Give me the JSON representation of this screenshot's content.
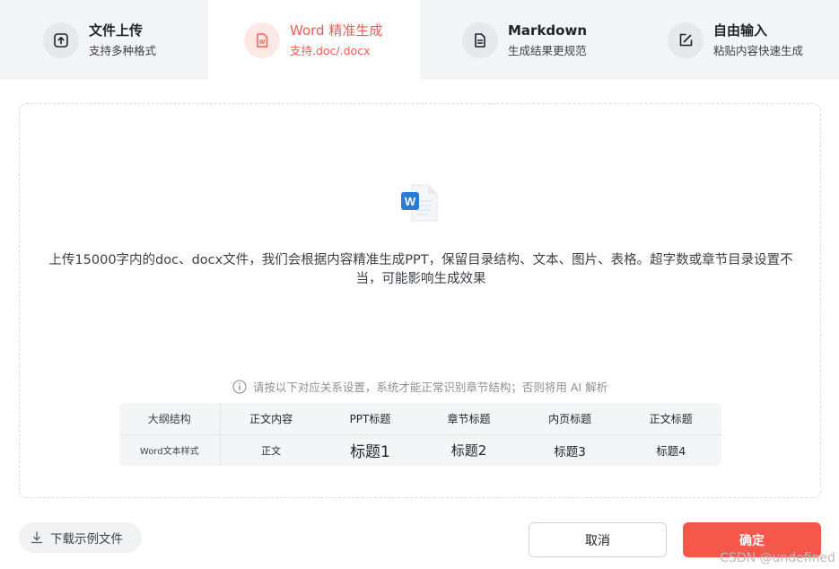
{
  "tabs": [
    {
      "title": "文件上传",
      "subtitle": "支持多种格式",
      "icon": "upload-icon"
    },
    {
      "title": "Word 精准生成",
      "subtitle": "支持.doc/.docx",
      "icon": "word-icon",
      "active": true
    },
    {
      "title": "Markdown",
      "subtitle": "生成结果更规范",
      "icon": "document-icon"
    },
    {
      "title": "自由输入",
      "subtitle": "粘贴内容快速生成",
      "icon": "edit-icon"
    }
  ],
  "dropzone": {
    "file_icon": "word-file-icon",
    "icon_letter": "W",
    "description": "上传15000字内的doc、docx文件，我们会根据内容精准生成PPT，保留目录结构、文本、图片、表格。超字数或章节目录设置不当，可能影响生成效果",
    "notice": "请按以下对应关系设置，系统才能正常识别章节结构；否则将用 AI 解析"
  },
  "mapping_table": {
    "row1_header": "大纲结构",
    "row1": [
      "正文内容",
      "PPT标题",
      "章节标题",
      "内页标题",
      "正文标题"
    ],
    "row2_header": "Word文本样式",
    "row2": [
      "正文",
      "标题1",
      "标题2",
      "标题3",
      "标题4"
    ]
  },
  "footer": {
    "download_label": "下载示例文件",
    "cancel_label": "取消",
    "confirm_label": "确定"
  },
  "watermark": "CSDN @undefined",
  "colors": {
    "accent": "#f5584a",
    "tab_bg": "#f3f4f6",
    "word_blue": "#2b7cd3"
  }
}
